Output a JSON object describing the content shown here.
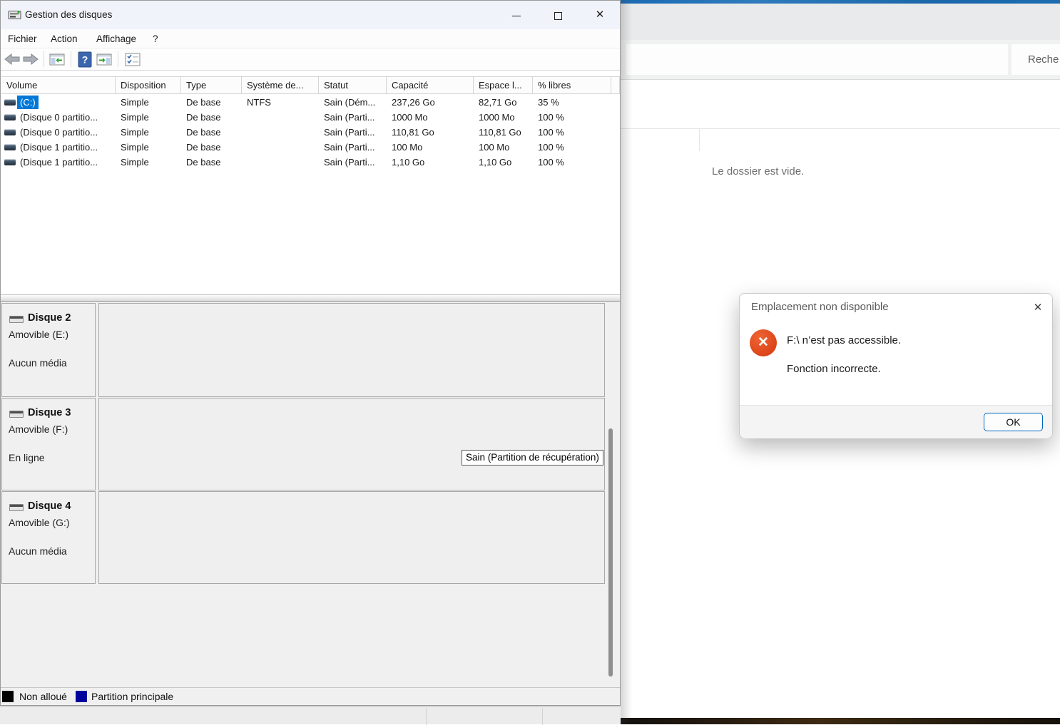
{
  "disk_management": {
    "title": "Gestion des disques",
    "menu": [
      "Fichier",
      "Action",
      "Affichage",
      "?"
    ],
    "table": {
      "columns": [
        "Volume",
        "Disposition",
        "Type",
        "Système de...",
        "Statut",
        "Capacité",
        "Espace l...",
        "% libres"
      ],
      "rows": [
        {
          "cells": [
            "(C:)",
            "Simple",
            "De base",
            "NTFS",
            "Sain (Dém...",
            "237,26 Go",
            "82,71 Go",
            "35 %"
          ],
          "selected": true
        },
        {
          "cells": [
            "(Disque 0 partitio...",
            "Simple",
            "De base",
            "",
            "Sain (Parti...",
            "1000 Mo",
            "1000 Mo",
            "100 %"
          ],
          "selected": false
        },
        {
          "cells": [
            "(Disque 0 partitio...",
            "Simple",
            "De base",
            "",
            "Sain (Parti...",
            "110,81 Go",
            "110,81 Go",
            "100 %"
          ],
          "selected": false
        },
        {
          "cells": [
            "(Disque 1 partitio...",
            "Simple",
            "De base",
            "",
            "Sain (Parti...",
            "100 Mo",
            "100 Mo",
            "100 %"
          ],
          "selected": false
        },
        {
          "cells": [
            "(Disque 1 partitio...",
            "Simple",
            "De base",
            "",
            "Sain (Parti...",
            "1,10 Go",
            "1,10 Go",
            "100 %"
          ],
          "selected": false
        }
      ]
    },
    "disks": [
      {
        "name": "Disque 2",
        "subtitle": "Amovible (E:)",
        "status": "Aucun média"
      },
      {
        "name": "Disque 3",
        "subtitle": "Amovible (F:)",
        "status": "En ligne"
      },
      {
        "name": "Disque 4",
        "subtitle": "Amovible (G:)",
        "status": "Aucun média"
      }
    ],
    "tooltip": "Sain (Partition de récupération)",
    "legend": [
      {
        "label": "Non alloué",
        "color": "#000000"
      },
      {
        "label": "Partition principale",
        "color": "#00009c"
      }
    ]
  },
  "explorer": {
    "search_text": "Reche",
    "empty_message": "Le dossier est vide."
  },
  "dialog": {
    "title": "Emplacement non disponible",
    "message_line1": "F:\\ n’est pas accessible.",
    "message_line2": "Fonction incorrecte.",
    "ok_label": "OK",
    "close_glyph": "✕"
  },
  "colors": {
    "selection_blue": "#0078d7",
    "error_red": "#dc451a",
    "primary_partition_navy": "#00009c",
    "unallocated_black": "#000000"
  }
}
